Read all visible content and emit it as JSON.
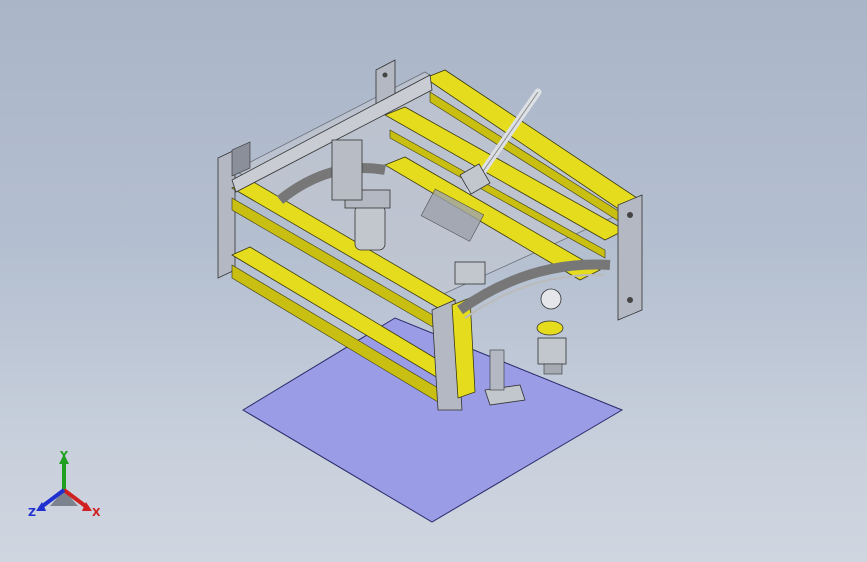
{
  "viewport": {
    "background_top": "#aab5c8",
    "background_bottom": "#d0d6e0"
  },
  "model": {
    "ground_plane_color": "#9a9de6",
    "extrusion_color": "#e6dc1e",
    "frame_color": "#b4b8c2",
    "steel_color": "#8a8f99"
  },
  "triad": {
    "x_label": "X",
    "y_label": "Y",
    "z_label": "Z",
    "x_color": "#d02020",
    "y_color": "#20a020",
    "z_color": "#2030d0"
  }
}
